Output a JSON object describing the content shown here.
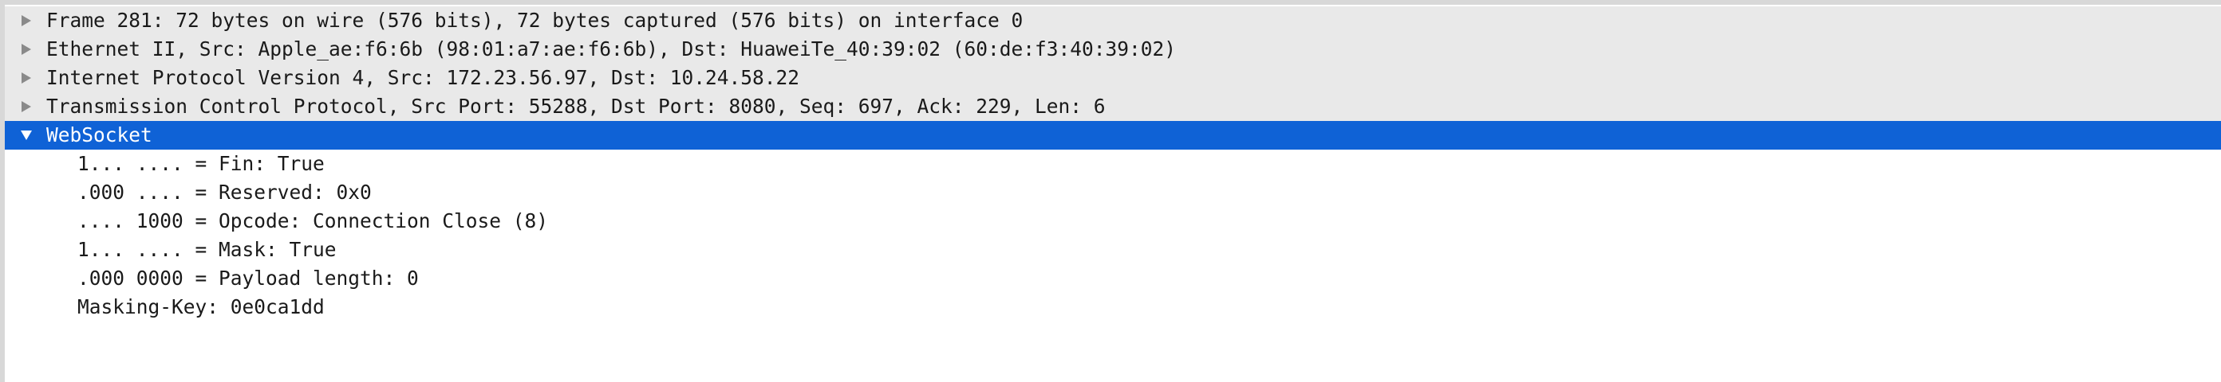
{
  "packet_details": {
    "rows": [
      {
        "label": "Frame 281: 72 bytes on wire (576 bits), 72 bytes captured (576 bits) on interface 0",
        "expanded": false
      },
      {
        "label": "Ethernet II, Src: Apple_ae:f6:6b (98:01:a7:ae:f6:6b), Dst: HuaweiTe_40:39:02 (60:de:f3:40:39:02)",
        "expanded": false
      },
      {
        "label": "Internet Protocol Version 4, Src: 172.23.56.97, Dst: 10.24.58.22",
        "expanded": false
      },
      {
        "label": "Transmission Control Protocol, Src Port: 55288, Dst Port: 8080, Seq: 697, Ack: 229, Len: 6",
        "expanded": false
      },
      {
        "label": "WebSocket",
        "expanded": true,
        "selected": true
      },
      {
        "label": "1... .... = Fin: True"
      },
      {
        "label": ".000 .... = Reserved: 0x0"
      },
      {
        "label": ".... 1000 = Opcode: Connection Close (8)"
      },
      {
        "label": "1... .... = Mask: True"
      },
      {
        "label": ".000 0000 = Payload length: 0"
      },
      {
        "label": "Masking-Key: 0e0ca1dd"
      }
    ]
  },
  "icons": {
    "collapsed": "triangle-right-icon",
    "expanded": "triangle-down-icon"
  },
  "colors": {
    "selected_bg": "#0f62d6",
    "collapsed_bg": "#e9e9e9",
    "triangle_gray": "#8a8a8a"
  }
}
